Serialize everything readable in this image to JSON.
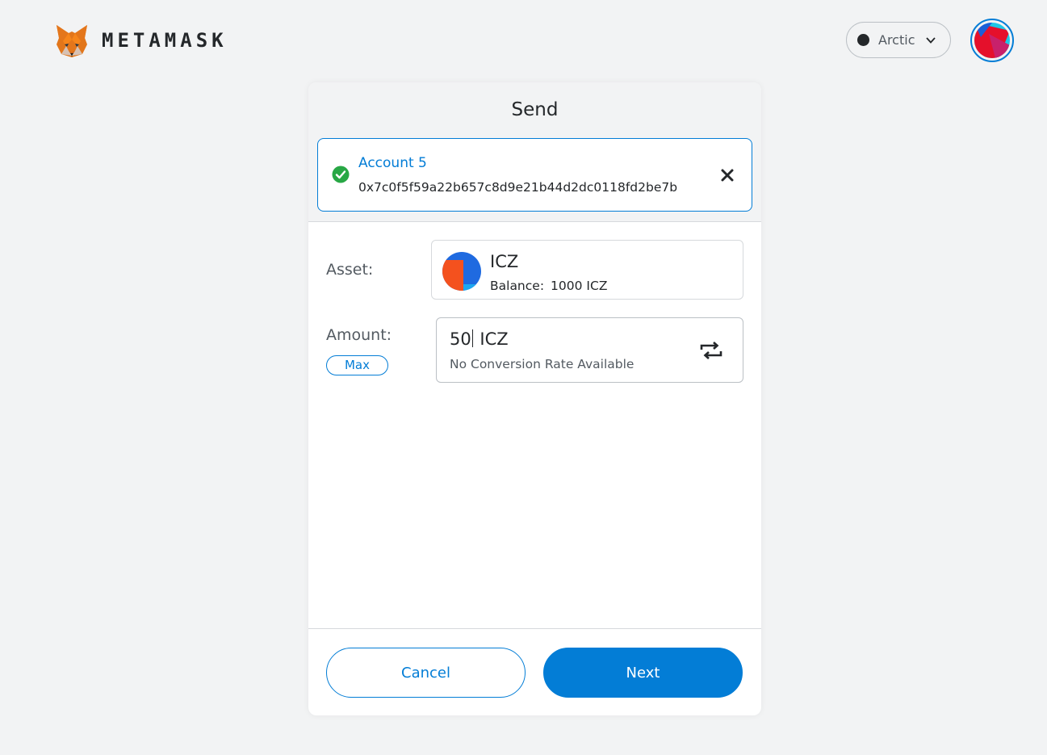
{
  "header": {
    "brand": "METAMASK",
    "network": {
      "name": "Arctic",
      "dot_color": "#24272a"
    }
  },
  "send": {
    "title": "Send",
    "recipient": {
      "name": "Account 5",
      "address": "0x7c0f5f59a22b657c8d9e21b44d2dc0118fd2be7b",
      "status_icon": "check-circle-icon",
      "clear_icon": "close-icon"
    },
    "asset": {
      "label": "Asset:",
      "symbol": "ICZ",
      "balance_label": "Balance:",
      "balance_value": "1000 ICZ"
    },
    "amount": {
      "label": "Amount:",
      "max_label": "Max",
      "value": "50",
      "unit": "ICZ",
      "conversion": "No Conversion Rate Available",
      "swap_icon": "swap-arrows-icon"
    },
    "actions": {
      "cancel": "Cancel",
      "next": "Next"
    }
  },
  "colors": {
    "primary": "#037dd6",
    "success": "#28a745",
    "background": "#f2f3f4",
    "text": "#24272a"
  }
}
